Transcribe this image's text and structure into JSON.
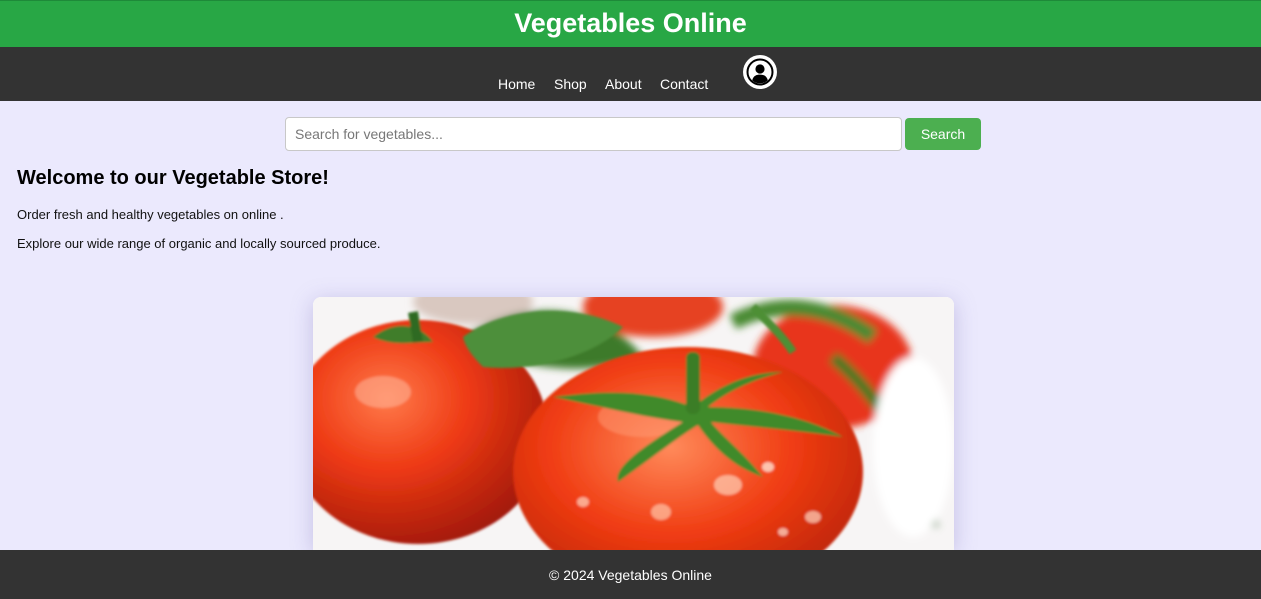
{
  "header": {
    "title": "Vegetables Online",
    "bg_color": "#28a745"
  },
  "nav": {
    "items": [
      {
        "label": "Home"
      },
      {
        "label": "Shop"
      },
      {
        "label": "About"
      },
      {
        "label": "Contact"
      }
    ],
    "profile_icon": "user-circle-icon",
    "bg_color": "#333333"
  },
  "search": {
    "placeholder": "Search for vegetables...",
    "value": "",
    "button_label": "Search",
    "button_color": "#4caf50"
  },
  "welcome": {
    "heading": "Welcome to our Vegetable Store!",
    "line1": "Order fresh and healthy vegetables on online .",
    "line2": "Explore our wide range of organic and locally sourced produce."
  },
  "hero": {
    "image": "tomatoes-photo"
  },
  "footer": {
    "text": "© 2024 Vegetables Online"
  }
}
